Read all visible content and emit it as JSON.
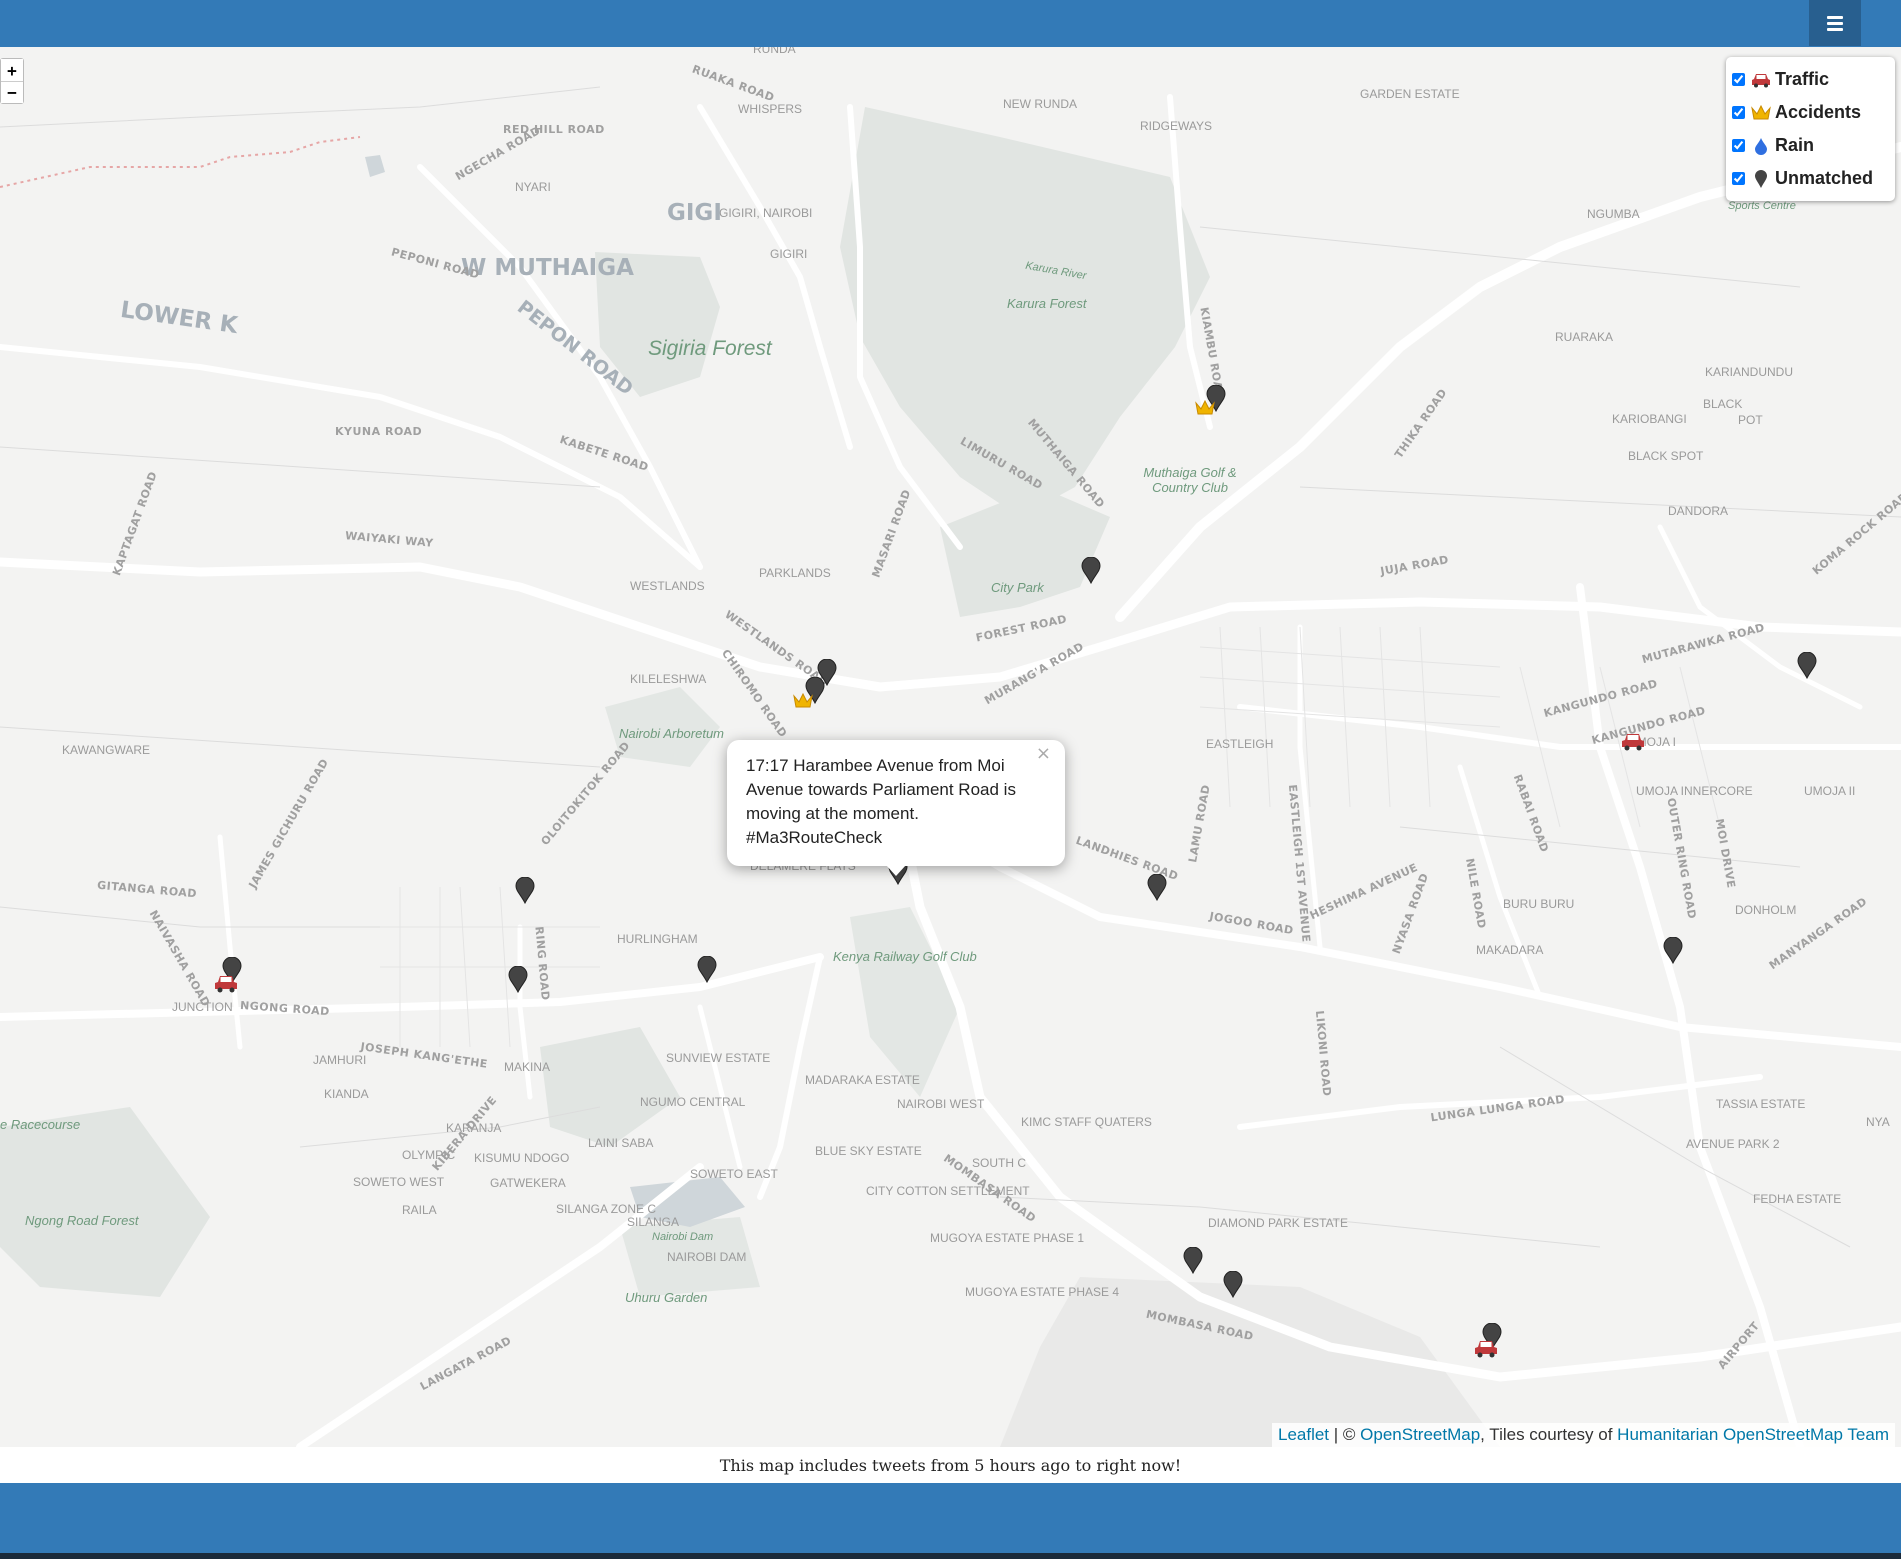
{
  "header": {
    "menu_icon": "hamburger-icon"
  },
  "zoom": {
    "in_label": "+",
    "out_label": "−"
  },
  "layers": [
    {
      "label": "Traffic",
      "checked": true,
      "icon": "car-icon",
      "color": "#c0393b"
    },
    {
      "label": "Accidents",
      "checked": true,
      "icon": "crown-icon",
      "color": "#f0b400"
    },
    {
      "label": "Rain",
      "checked": true,
      "icon": "raindrop-icon",
      "color": "#2f6fe0"
    },
    {
      "label": "Unmatched",
      "checked": true,
      "icon": "pin-icon",
      "color": "#444444"
    }
  ],
  "popup": {
    "text": "17:17 Harambee Avenue from Moi Avenue towards Parliament Road is moving at the moment. #Ma3RouteCheck",
    "close_label": "×"
  },
  "attribution": {
    "leaflet": "Leaflet",
    "separator": " | © ",
    "osm": "OpenStreetMap",
    "tiles_text": ", Tiles courtesy of ",
    "hot": "Humanitarian OpenStreetMap Team"
  },
  "caption": "This map includes tweets from 5 hours ago to right now!",
  "map_labels": {
    "places": [
      "RUNDA",
      "WHISPERS",
      "NEW RUNDA",
      "GARDEN ESTATE",
      "RIDGEWAYS",
      "NYARI",
      "GIGIRI, NAIROBI",
      "GIGIRI",
      "NGUMBA",
      "RUARAKA",
      "KARIANDUNDU",
      "BLACK",
      "POT",
      "KARIOBANGI",
      "BLACK SPOT",
      "DANDORA",
      "PARKLANDS",
      "WESTLANDS",
      "KILELESHWA",
      "KAWANGWARE",
      "EASTLEIGH",
      "UMOJA I",
      "UMOJA INNERCORE",
      "UMOJA II",
      "DELAMERE FLATS",
      "HURLINGHAM",
      "JUNCTION",
      "BURU BURU",
      "DONHOLM",
      "MAKADARA",
      "JAMHURI",
      "MAKINA",
      "SUNVIEW ESTATE",
      "MADARAKA ESTATE",
      "NGUMO CENTRAL",
      "NAIROBI WEST",
      "KIMC STAFF QUATERS",
      "TASSIA ESTATE",
      "AVENUE PARK 2",
      "KIANDA",
      "KARANJA",
      "OLYMPIC",
      "KISUMU NDOGO",
      "LAINI SABA",
      "BLUE SKY ESTATE",
      "SOUTH C",
      "SOWETO WEST",
      "GATWEKERA",
      "SOWETO EAST",
      "SILANGA ZONE C",
      "CITY COTTON SETTLEMENT",
      "RAILA",
      "SILANGA",
      "MUGOYA ESTATE PHASE 1",
      "DIAMOND PARK ESTATE",
      "FEDHA ESTATE",
      "NAIROBI DAM",
      "MUGOYA ESTATE PHASE 4",
      "NYA"
    ],
    "big": [
      "W MUTHAIGA",
      "GIGI",
      "LOWER K",
      "PEPON ROAD"
    ],
    "green": [
      "Sigiria Forest",
      "Karura Forest",
      "Karura River",
      "Muthaiga Golf & Country Club",
      "City Park",
      "Nairobi Arboretum",
      "Kenya Railway Golf Club",
      "Uhuru Garden",
      "Ngong Road Forest",
      "e Racecourse",
      "Nairobi Dam",
      "International Sports Centre"
    ],
    "roads": [
      "RUAKA ROAD",
      "RED HILL ROAD",
      "NGECHA ROAD",
      "PEPONI ROAD",
      "KYUNA ROAD",
      "KABETE ROAD",
      "WAIYAKI WAY",
      "LIMURU ROAD",
      "MUTHAIGA ROAD",
      "KIAMBU ROAD",
      "THIKA ROAD",
      "JUJA ROAD",
      "FOREST ROAD",
      "MURANG'A ROAD",
      "WESTLANDS ROAD",
      "CHIROMO ROAD",
      "LANDHIES ROAD",
      "JOGOO ROAD",
      "NGONG ROAD",
      "OUTER RING ROAD",
      "KANGUNDO ROAD",
      "MOMBASA ROAD",
      "LANGATA ROAD",
      "LUNGA LUNGA ROAD",
      "GITANGA ROAD",
      "NAIVASHA ROAD",
      "KIBERA DRIVE",
      "JOSEPH KANG'ETHE",
      "KOMA ROCK ROAD",
      "MUTARAWKA ROAD",
      "MANYANGA ROAD",
      "HESHIMA AVENUE",
      "NYASA ROAD",
      "NILE ROAD",
      "RABAI ROAD",
      "LIKONI ROAD",
      "EASTLEIGH 1ST AVENUE",
      "LAMU ROAD",
      "MASARI ROAD",
      "OLOITOKITOK ROAD",
      "JAMES GICHURU ROAD",
      "KAPTAGAT ROAD",
      "RING ROAD",
      "MOI DRIVE",
      "KANGUNDO ROAD",
      "MOMBASA ROAD",
      "AIRPORT"
    ]
  },
  "markers": [
    {
      "type": "pin-icon",
      "color": "#444444"
    },
    {
      "type": "crown-icon",
      "color": "#f0b400"
    },
    {
      "type": "car-icon",
      "color": "#c0393b"
    }
  ]
}
